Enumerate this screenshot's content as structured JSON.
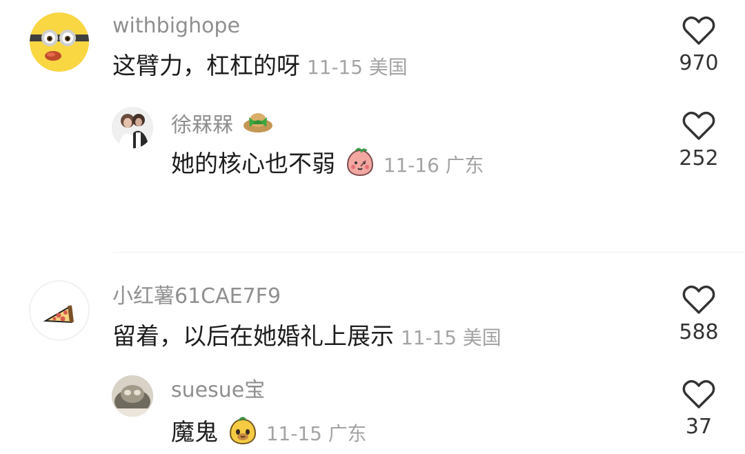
{
  "comments": [
    {
      "username": "withbighope",
      "text": "这臂力，杠杠的呀",
      "date": "11-15",
      "location": "美国",
      "likes": "970",
      "avatar_icon": "minion-avatar",
      "reply": {
        "username": "徐槑槑",
        "text": "她的核心也不弱",
        "date": "11-16",
        "location": "广东",
        "likes": "252",
        "avatar_icon": "wedding-couple-avatar",
        "badge_icon": "straw-hat-badge",
        "emoji_icon": "peach-face-emoji"
      }
    },
    {
      "username": "小红薯61CAE7F9",
      "text": "留着，以后在她婚礼上展示",
      "date": "11-15",
      "location": "美国",
      "likes": "588",
      "avatar_icon": "pizza-slice-avatar",
      "reply": {
        "username": "suesue宝",
        "text": "魔鬼",
        "date": "11-15",
        "location": "广东",
        "likes": "37",
        "avatar_icon": "profile-photo-avatar",
        "emoji_icon": "dog-face-emoji"
      }
    }
  ],
  "colors": {
    "username": "#8f8f8f",
    "content": "#1d1d1d",
    "meta": "#a3a3a3",
    "like": "#333333",
    "divider": "#efefef"
  }
}
